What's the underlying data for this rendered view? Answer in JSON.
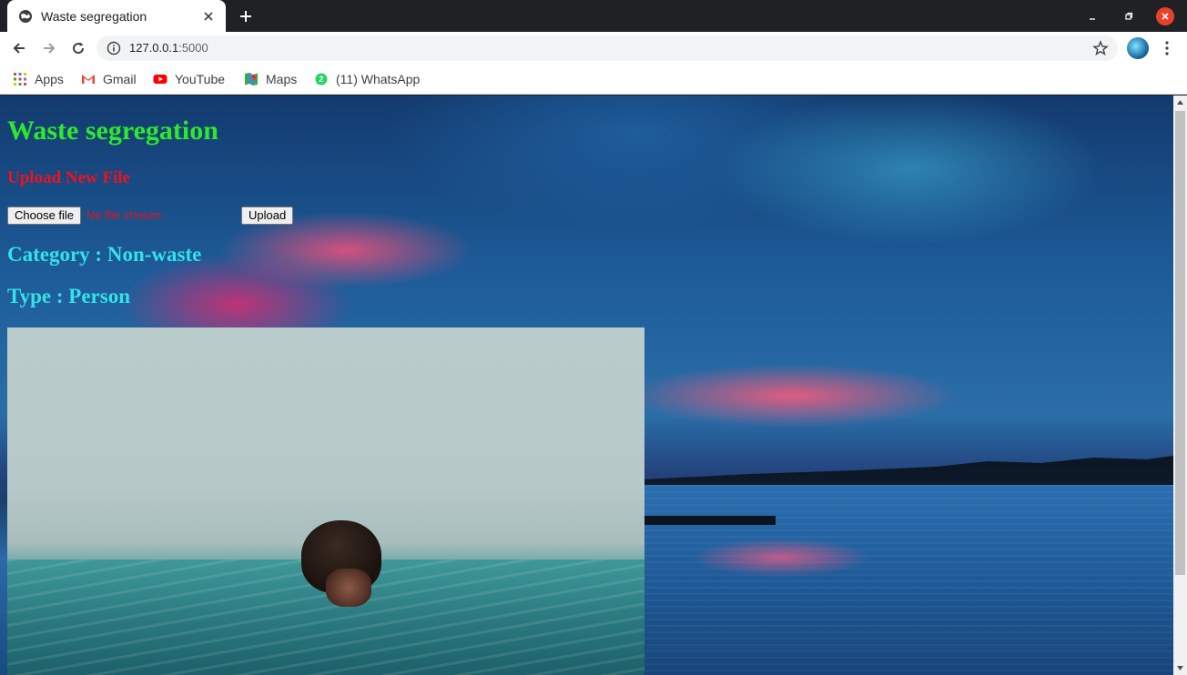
{
  "browser": {
    "tab_title": "Waste segregation",
    "url_host": "127.0.0.1",
    "url_port": ":5000",
    "icons": [
      "globe-icon",
      "close-icon",
      "plus-icon",
      "minimize-icon",
      "restore-icon",
      "window-close-icon",
      "back-icon",
      "forward-icon",
      "reload-icon",
      "info-icon",
      "star-icon",
      "kebab-menu-icon"
    ]
  },
  "bookmarks": [
    {
      "label": "Apps",
      "icon": "apps-grid-icon"
    },
    {
      "label": "Gmail",
      "icon": "gmail-icon"
    },
    {
      "label": "YouTube",
      "icon": "youtube-icon"
    },
    {
      "label": "Maps",
      "icon": "maps-icon"
    },
    {
      "label": "(11) WhatsApp",
      "icon": "whatsapp-icon"
    }
  ],
  "page": {
    "title": "Waste segregation",
    "upload_heading": "Upload New File",
    "choose_file_label": "Choose file",
    "no_file_text": "No file chosen",
    "upload_button": "Upload",
    "category_text": "Category : Non-waste",
    "type_text": "Type : Person"
  },
  "colors": {
    "title": "#2ee82e",
    "upload_heading": "#ee1122",
    "result_text": "#33e2e8",
    "window_close": "#e8412b"
  }
}
